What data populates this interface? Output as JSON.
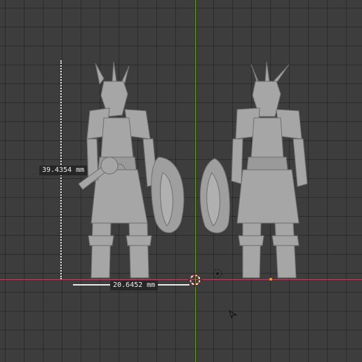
{
  "viewport": {
    "colors": {
      "background": "#3d3d3d",
      "grid": "#343434",
      "x_axis": "#b5454f",
      "y_axis": "#6e9a2c",
      "model": "#a6a6a6",
      "origin": "#f2a01e"
    }
  },
  "measurements": {
    "height_label": "39.4354 mm",
    "width_label": "20.6452 mm"
  },
  "icons": {
    "cursor": "3d-cursor-icon",
    "light": "light-icon",
    "pointer": "mouse-pointer-icon"
  }
}
